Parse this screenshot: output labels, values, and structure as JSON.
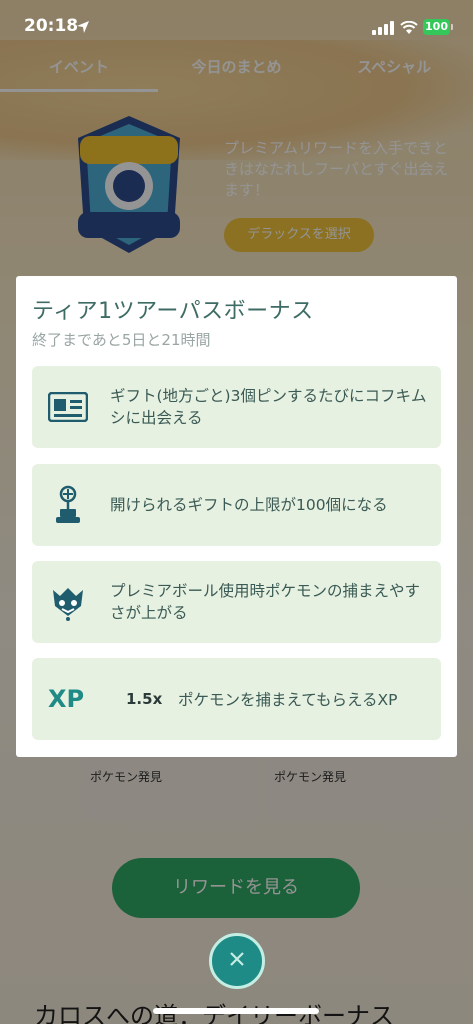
{
  "status": {
    "time": "20:18",
    "battery": "100"
  },
  "background": {
    "tabs": [
      "イベント",
      "今日のまとめ",
      "スペシャル"
    ],
    "promo_text": "プレミアムリワードを入手できときはなたれしフーパとすぐ出会えます！",
    "promo_button": "デラックスを選択",
    "card_label_1": "ポケモン発見",
    "card_label_2": "ポケモン発見",
    "rewards_button": "リワードを見る",
    "daily_heading": "カロスへの道：デイリーボーナス"
  },
  "modal": {
    "title": "ティア1ツアーパスボーナス",
    "subtitle": "終了まであと5日と21時間",
    "bonuses": [
      {
        "icon": "map-card-icon",
        "text": "ギフト(地方ごと)3個ピンするたびにコフキムシに出会える"
      },
      {
        "icon": "gift-stand-icon",
        "text": "開けられるギフトの上限が100個になる"
      },
      {
        "icon": "premier-pokemon-icon",
        "text": "プレミアボール使用時ポケモンの捕まえやすさが上がる"
      },
      {
        "icon": "xp-icon",
        "xp_label": "XP",
        "multiplier": "1.5x",
        "text": "ポケモンを捕まえてもらえるXP"
      }
    ]
  },
  "close_icon": "close-icon",
  "colors": {
    "accent": "#1f8b86",
    "bonus_bg": "#e7f1e1",
    "title": "#3e6b64"
  }
}
